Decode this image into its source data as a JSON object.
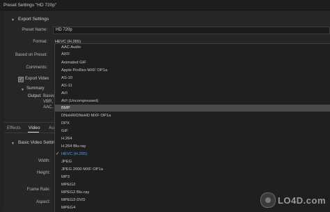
{
  "window": {
    "title": "Preset Settings \"HD 720p\""
  },
  "export_settings": {
    "header": "Export Settings",
    "preset_name_label": "Preset Name:",
    "preset_name_value": "HD 720p",
    "format_label": "Format:",
    "format_value": "HEVC (H.265)",
    "based_on_label": "Based on Preset:",
    "comments_label": "Comments:",
    "export_video_label": "Export Video",
    "export_video_checked": true,
    "summary_header": "Summary",
    "summary_output_label": "Output:",
    "summary_lines": [
      "Based",
      "VBR, 1",
      "AAC, 3"
    ]
  },
  "tabs": [
    {
      "label": "Effects",
      "active": false
    },
    {
      "label": "Video",
      "active": true
    },
    {
      "label": "Au",
      "active": false
    }
  ],
  "video_settings": {
    "header": "Basic Video Setting",
    "width_label": "Width:",
    "height_label": "Height:",
    "frame_rate_label": "Frame Rate:",
    "aspect_label": "Aspect:"
  },
  "format_dropdown": {
    "options": [
      "AAC Audio",
      "AIFF",
      "Animated GIF",
      "Apple ProRes MXF OP1a",
      "AS-10",
      "AS-11",
      "AVI",
      "AVI (Uncompressed)",
      "BMP",
      "DNxHR/DNxHD MXF OP1a",
      "DPX",
      "GIF",
      "H.264",
      "H.264 Blu-ray",
      "HEVC (H.265)",
      "JPEG",
      "JPEG 2000 MXF OP1a",
      "MP3",
      "MPEG2",
      "MPEG2 Blu-ray",
      "MPEG2-DVD",
      "MPEG4"
    ],
    "highlighted": "BMP",
    "selected": "HEVC (H.265)"
  },
  "watermark": {
    "text": "LO4D.com"
  },
  "colors": {
    "selected_text": "#4aa3ff",
    "highlight": "#4a4a4a",
    "background": "#232323"
  }
}
